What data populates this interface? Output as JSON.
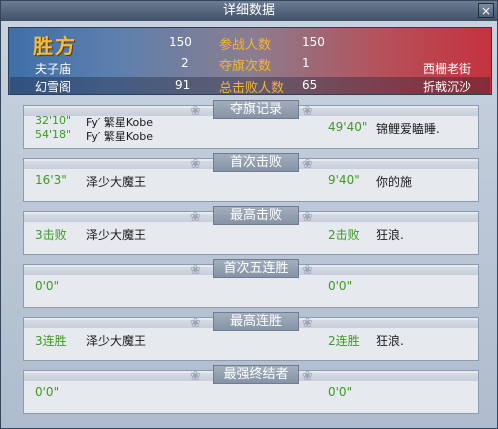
{
  "window": {
    "title": "详细数据",
    "close_label": "×"
  },
  "scoreboard": {
    "winner_label": "胜方",
    "left_team_1": "夫子庙",
    "left_team_2": "幻雪阁",
    "right_team_1": "西栅老街",
    "right_team_2": "折戟沉沙",
    "rows": [
      {
        "label": "参战人数",
        "left": "150",
        "right": "150"
      },
      {
        "label": "夺旗次数",
        "left": "2",
        "right": "1"
      },
      {
        "label": "总击败人数",
        "left": "91",
        "right": "65"
      }
    ]
  },
  "sections": {
    "flag": {
      "title": "夺旗记录",
      "left_time_1": "32'10\"",
      "left_name_1": "Fy′ 繁星Kobe",
      "left_time_2": "54'18\"",
      "left_name_2": "Fy′ 繁星Kobe",
      "right_time": "49'40\"",
      "right_name": "锦鲤爱瞌睡."
    },
    "first_kill": {
      "title": "首次击败",
      "left_value": "16'3\"",
      "left_name": "泽少大魔王",
      "right_value": "9'40\"",
      "right_name": "你的施"
    },
    "max_kill": {
      "title": "最高击败",
      "left_value": "3击败",
      "left_name": "泽少大魔王",
      "right_value": "2击败",
      "right_name": "狂浪."
    },
    "first_five": {
      "title": "首次五连胜",
      "left_value": "0'0\"",
      "right_value": "0'0\""
    },
    "max_streak": {
      "title": "最高连胜",
      "left_value": "3连胜",
      "left_name": "泽少大魔王",
      "right_value": "2连胜",
      "right_name": "狂浪."
    },
    "terminator": {
      "title": "最强终结者",
      "left_value": "0'0\"",
      "right_value": "0'0\""
    }
  },
  "colors": {
    "value_green": "#3d9a22",
    "label_gold": "#f3b437",
    "winner_gold": "#f6bd3a"
  }
}
